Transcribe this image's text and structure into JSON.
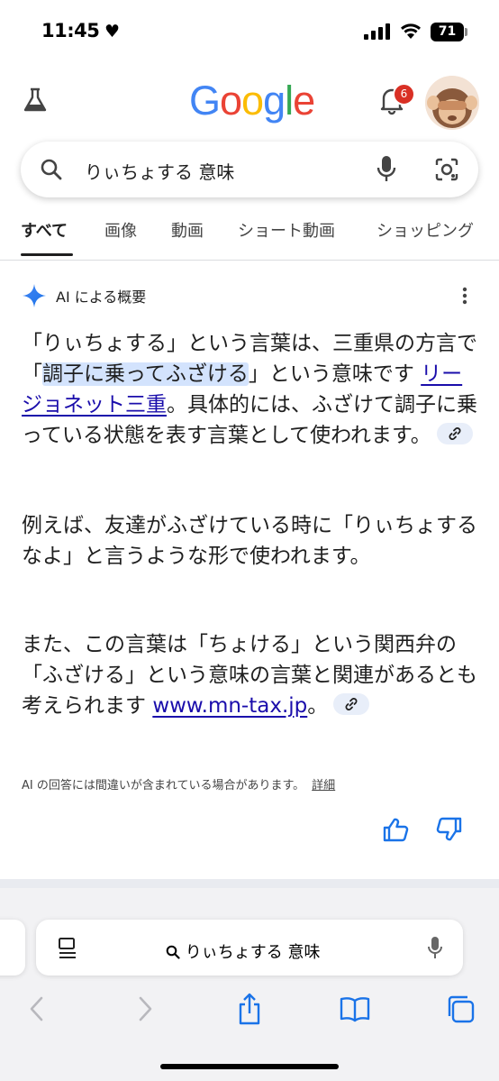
{
  "status": {
    "time": "11:45",
    "battery": "71"
  },
  "header": {
    "logo": [
      "G",
      "o",
      "o",
      "g",
      "l",
      "e"
    ],
    "logo_colors": [
      "#4285F4",
      "#EA4335",
      "#FBBC05",
      "#4285F4",
      "#34A853",
      "#EA4335"
    ],
    "notification_count": "6"
  },
  "search": {
    "query": "りぃちょする 意味"
  },
  "tabs": [
    {
      "label": "すべて",
      "active": true
    },
    {
      "label": "画像"
    },
    {
      "label": "動画"
    },
    {
      "label": "ショート動画"
    },
    {
      "label": "ショッピング"
    }
  ],
  "ai_overview": {
    "title": "AI による概要",
    "p1": {
      "a": "「りぃちょする」という言葉は、三重県の方言で「",
      "highlight": "調子に乗ってふざける",
      "b": "」という意味です ",
      "link": "リージョネット三重",
      "c": "。具体的には、ふざけて調子に乗っている状態を表す言葉として使われます。"
    },
    "p2": "例えば、友達がふざけている時に「りぃちょするなよ」と言うような形で使われます。",
    "p3": {
      "a": "また、この言葉は「ちょける」という関西弁の「ふざける」という意味の言葉と関連があるとも考えられます ",
      "link": "www.mn-tax.jp",
      "c": "。"
    },
    "disclaimer": "AI の回答には間違いが含まれている場合があります。",
    "details_link": "詳細"
  },
  "safari": {
    "url_text": "りぃちょする 意味"
  },
  "colors": {
    "accent": "#1a73e8",
    "link": "#1a0dab",
    "highlight": "#d3e3fd",
    "badge": "#d93025"
  }
}
